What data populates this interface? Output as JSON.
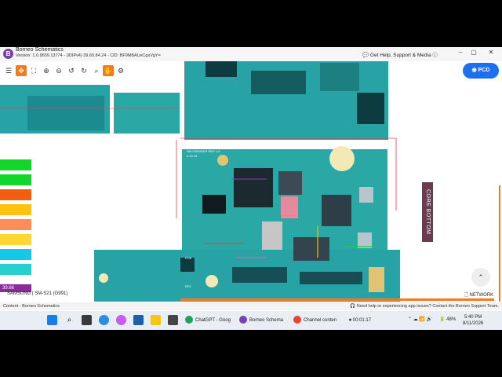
{
  "window": {
    "title": "Borneo Schematics",
    "version": "Version: 1.0.9659.13774 - (IDIPv4) 39.60.84.24 - CID: BF9MBAUxCgxVgY=",
    "help_link": "Get Help, Support & Media",
    "help_icon": "chat-icon",
    "controls": [
      "–",
      "▢",
      "✕"
    ]
  },
  "toolbar": {
    "tools": [
      "list-icon",
      "move-icon",
      "fit-icon",
      "zoom-in-icon",
      "zoom-out-icon",
      "undo-icon",
      "redo-icon",
      "search-icon",
      "hand-icon",
      "settings-icon"
    ],
    "active_tool": "hand-icon",
    "pcd_button": "PCD"
  },
  "viewer": {
    "core_label": "CORE BOTTOM",
    "board_marks": [
      "DAPB11101",
      "SM-G991B/DS REV 1.0",
      "0.10.15",
      "PCB",
      "DP1"
    ],
    "legend_colors": [
      "#12d62a",
      "#12d62a",
      "#f25f0f",
      "#ffc20e",
      "#ff8d5a",
      "#fdd835",
      "#15c8e8",
      "#26d0ce",
      "#8a2b9a"
    ],
    "net_badge": "39.66",
    "device": "SAMSUNG | SM-S21 (G991)",
    "network_label": "NETWORK",
    "accent": "#f47a20"
  },
  "statusbar": {
    "left": "Content - Borneo Schematics",
    "right": "Need help or experiencing app issues? Contact the Borneo Support Team."
  },
  "taskbar": {
    "items": [
      {
        "label": "ChatGPT - Goog",
        "color": "#1aa260"
      },
      {
        "label": "Borneo Schema",
        "color": "#7b3fb2"
      },
      {
        "label": "Channel conten",
        "color": "#ea4335"
      }
    ],
    "timer": "00:01:17",
    "battery": "48%",
    "time": "5:40 PM",
    "date": "8/11/2026"
  }
}
